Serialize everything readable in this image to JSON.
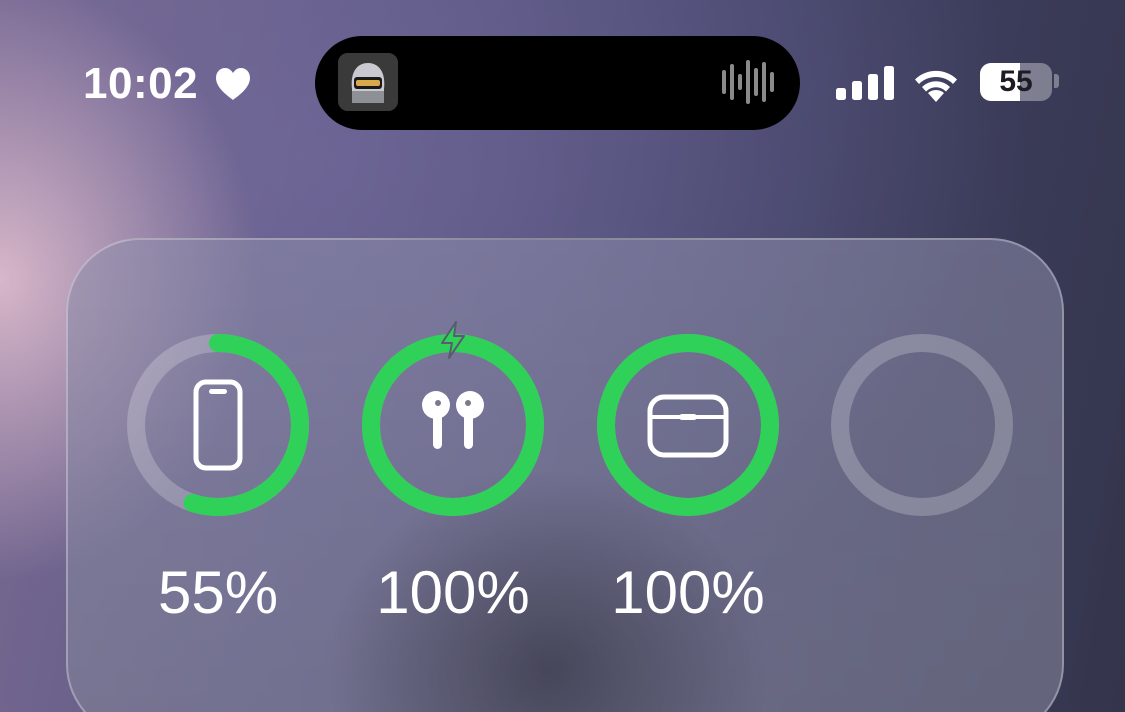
{
  "status_bar": {
    "time": "10:02",
    "battery_level": "55",
    "battery_fraction": 0.55
  },
  "dynamic_island": {
    "album_art_icon": "album-art",
    "waveform_icon": "waveform-icon"
  },
  "battery_widget": {
    "ring_color": "#30d158",
    "track_color": "rgba(255,255,255,0.22)",
    "devices": [
      {
        "icon": "iphone-icon",
        "fraction": 0.55,
        "label": "55%",
        "charging": false
      },
      {
        "icon": "airpods-icon",
        "fraction": 1.0,
        "label": "100%",
        "charging": true
      },
      {
        "icon": "airpods-case-icon",
        "fraction": 1.0,
        "label": "100%",
        "charging": false
      },
      {
        "icon": "empty-slot",
        "fraction": 0,
        "label": "",
        "charging": false
      }
    ]
  }
}
